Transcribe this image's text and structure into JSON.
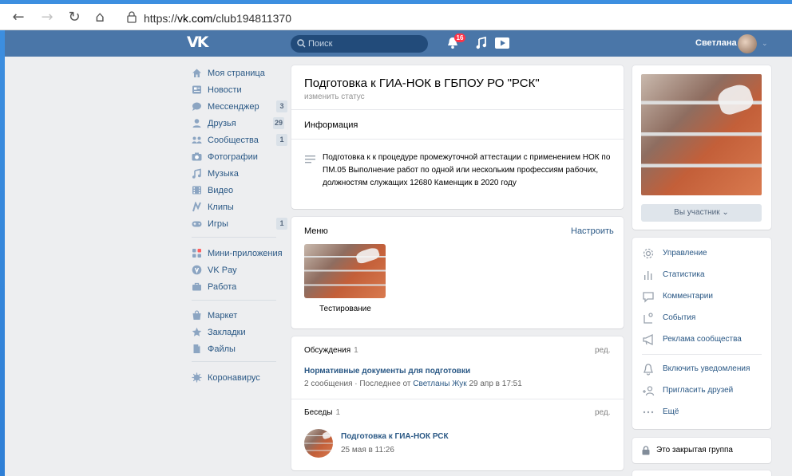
{
  "browser": {
    "url_prefix": "https://",
    "url_host": "vk.com",
    "url_path": "/club194811370"
  },
  "header": {
    "logo": "VK",
    "search_placeholder": "Поиск",
    "notifications_count": "16",
    "user_name": "Светлана"
  },
  "sidebar": {
    "items": [
      {
        "label": "Моя страница",
        "icon": "home-icon"
      },
      {
        "label": "Новости",
        "icon": "news-icon"
      },
      {
        "label": "Мессенджер",
        "icon": "messenger-icon",
        "count": "3"
      },
      {
        "label": "Друзья",
        "icon": "friends-icon",
        "count": "29"
      },
      {
        "label": "Сообщества",
        "icon": "communities-icon",
        "count": "1"
      },
      {
        "label": "Фотографии",
        "icon": "camera-icon"
      },
      {
        "label": "Музыка",
        "icon": "music-icon"
      },
      {
        "label": "Видео",
        "icon": "video-icon"
      },
      {
        "label": "Клипы",
        "icon": "clips-icon"
      },
      {
        "label": "Игры",
        "icon": "games-icon",
        "count": "1"
      },
      {
        "label": "Мини-приложения",
        "icon": "mini-apps-icon"
      },
      {
        "label": "VK Pay",
        "icon": "vkpay-icon"
      },
      {
        "label": "Работа",
        "icon": "work-icon"
      },
      {
        "label": "Маркет",
        "icon": "market-icon"
      },
      {
        "label": "Закладки",
        "icon": "star-icon"
      },
      {
        "label": "Файлы",
        "icon": "file-icon"
      },
      {
        "label": "Коронавирус",
        "icon": "virus-icon"
      }
    ]
  },
  "group": {
    "title": "Подготовка к ГИА-НОК в ГБПОУ РО \"РСК\"",
    "status_link": "изменить статус",
    "info_label": "Информация",
    "description": "Подготовка к к процедуре промежуточной аттестации с применением НОК по ПМ.05 Выполнение работ по одной или нескольким профессиям рабочих, должностям служащих 12680 Каменщик в 2020 году"
  },
  "menu_block": {
    "label": "Меню",
    "configure": "Настроить",
    "item_label": "Тестирование"
  },
  "discussions": {
    "label": "Обсуждения",
    "count": "1",
    "edit": "ред.",
    "topic_title": "Нормативные документы для подготовки",
    "topic_meta_prefix": "2 сообщения · Последнее от",
    "topic_meta_author": "Светланы Жук",
    "topic_meta_suffix": "29 апр в 17:51"
  },
  "chats": {
    "label": "Беседы",
    "count": "1",
    "edit": "ред.",
    "chat_title": "Подготовка к ГИА-НОК РСК",
    "chat_date": "25 мая в 11:26"
  },
  "right": {
    "member_button": "Вы участник ⌄",
    "admin_items": [
      {
        "label": "Управление",
        "icon": "gear-icon"
      },
      {
        "label": "Статистика",
        "icon": "stats-icon"
      },
      {
        "label": "Комментарии",
        "icon": "comment-icon"
      },
      {
        "label": "События",
        "icon": "events-icon"
      },
      {
        "label": "Реклама сообщества",
        "icon": "megaphone-icon"
      },
      {
        "label": "Включить уведомления",
        "icon": "bell-icon"
      },
      {
        "label": "Пригласить друзей",
        "icon": "invite-icon"
      },
      {
        "label": "Ещё",
        "icon": "more-icon"
      }
    ],
    "closed_group": "Это закрытая группа"
  },
  "colors": {
    "vk_blue": "#4a76a8",
    "link": "#2a5885",
    "background": "#edeef0"
  }
}
